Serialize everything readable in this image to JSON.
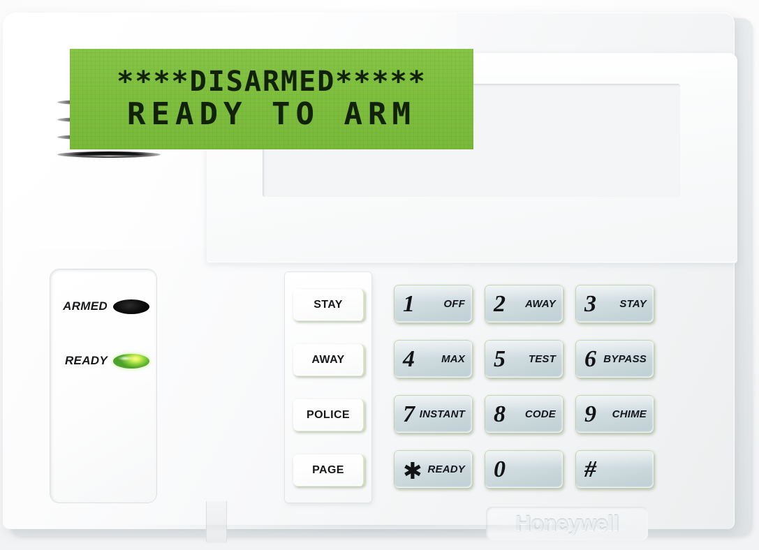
{
  "device": {
    "brand": "Honeywell",
    "type": "security-alarm-keypad"
  },
  "display": {
    "line1": "****DISARMED*****",
    "line2": "READY TO ARM",
    "backlight_color": "#7fbf3e",
    "text_color": "#12220a"
  },
  "status_panel": {
    "indicators": [
      {
        "label": "ARMED",
        "state": "off",
        "led_color": "#0d0d0e"
      },
      {
        "label": "READY",
        "state": "on",
        "led_color": "#8ed33c"
      }
    ]
  },
  "function_keys": [
    {
      "label": "STAY"
    },
    {
      "label": "AWAY"
    },
    {
      "label": "POLICE"
    },
    {
      "label": "PAGE"
    }
  ],
  "keypad": {
    "keys": [
      {
        "digit": "1",
        "sub": "OFF"
      },
      {
        "digit": "2",
        "sub": "AWAY"
      },
      {
        "digit": "3",
        "sub": "STAY"
      },
      {
        "digit": "4",
        "sub": "MAX"
      },
      {
        "digit": "5",
        "sub": "TEST"
      },
      {
        "digit": "6",
        "sub": "BYPASS"
      },
      {
        "digit": "7",
        "sub": "INSTANT"
      },
      {
        "digit": "8",
        "sub": "CODE"
      },
      {
        "digit": "9",
        "sub": "CHIME"
      },
      {
        "digit": "✱",
        "sub": "READY"
      },
      {
        "digit": "0",
        "sub": ""
      },
      {
        "digit": "#",
        "sub": ""
      }
    ]
  },
  "speaker": {
    "vent_count": 4
  },
  "colors": {
    "housing": "#f7f8f9",
    "key_face": "#cfdbdf",
    "key_edge_green": "#bcd39a",
    "lcd_green": "#7fbf3e"
  }
}
